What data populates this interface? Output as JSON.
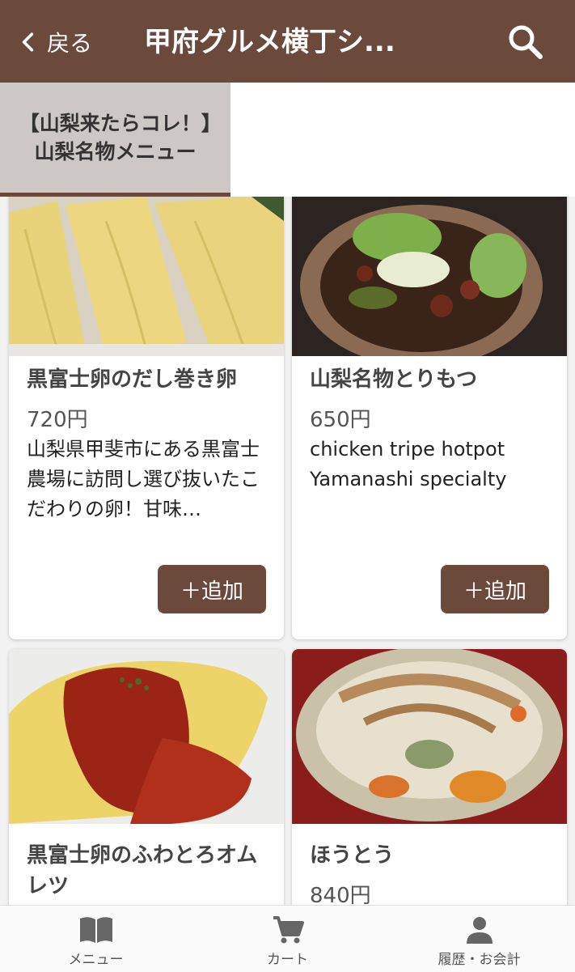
{
  "header": {
    "back_label": "戻る",
    "title": "甲府グルメ横丁シ...",
    "bg_color": "#6b4a3c"
  },
  "category_tab": {
    "label": "【山梨来たらコレ！】山梨名物メニュー"
  },
  "menu_items": [
    {
      "name": "黒富士卵のだし巻き卵",
      "price": "720円",
      "description": "山梨県甲斐市にある黒富士農場に訪問し選び抜いたこだわりの卵！甘味…",
      "add_label": "＋追加"
    },
    {
      "name": "山梨名物とりもつ",
      "price": "650円",
      "description": "chicken tripe hotpot Yamanashi specialty",
      "add_label": "＋追加"
    },
    {
      "name": "黒富士卵のふわとろオムレツ",
      "price": "",
      "description": "",
      "add_label": ""
    },
    {
      "name": "ほうとう",
      "price": "840円",
      "description": "",
      "add_label": ""
    }
  ],
  "bottom_nav": [
    {
      "label": "メニュー",
      "icon": "menu-book-icon"
    },
    {
      "label": "カート",
      "icon": "cart-icon"
    },
    {
      "label": "履歴・お会計",
      "icon": "person-icon"
    }
  ],
  "colors": {
    "accent": "#6b4a3c",
    "active_tab_bg": "#cdc8c6"
  }
}
